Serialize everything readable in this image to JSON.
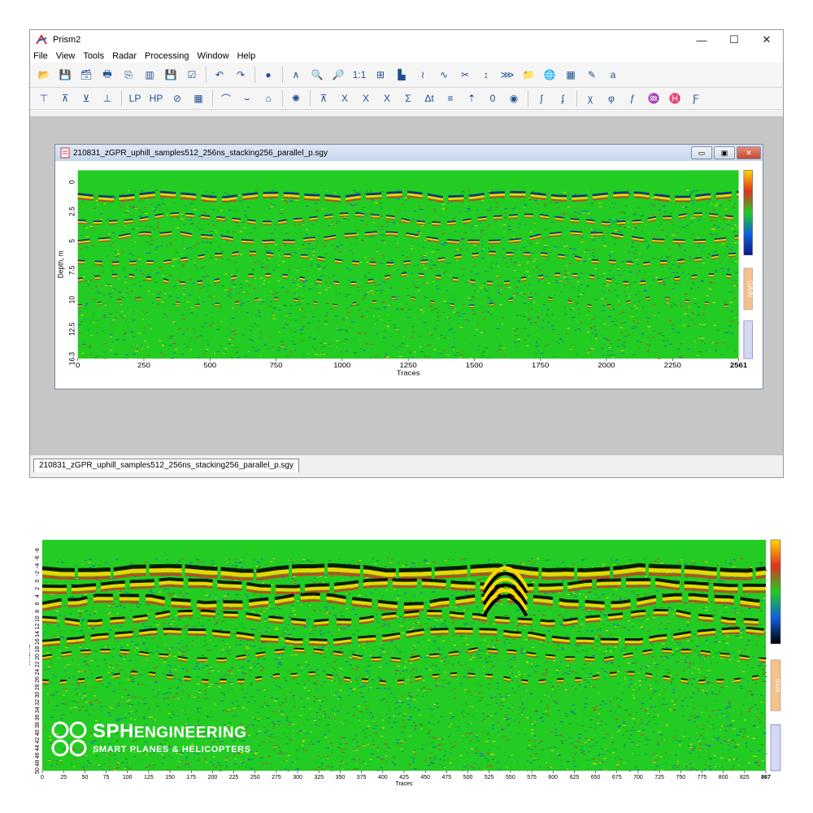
{
  "app": {
    "title": "Prism2",
    "minimize_glyph": "—",
    "maximize_glyph": "☐",
    "close_glyph": "✕"
  },
  "menu": {
    "items": [
      {
        "label": "File"
      },
      {
        "label": "View"
      },
      {
        "label": "Tools"
      },
      {
        "label": "Radar"
      },
      {
        "label": "Processing"
      },
      {
        "label": "Window"
      },
      {
        "label": "Help"
      }
    ]
  },
  "toolbar1": {
    "buttons": [
      {
        "icon": "open-folder-icon",
        "glyph": "📂"
      },
      {
        "icon": "save-icon",
        "glyph": "💾"
      },
      {
        "icon": "save-all-icon",
        "glyph": "🗃"
      },
      {
        "icon": "print-icon",
        "glyph": "🖶"
      },
      {
        "icon": "export-icon",
        "glyph": "⎘"
      },
      {
        "icon": "palette-icon",
        "glyph": "▥"
      },
      {
        "icon": "floppy-icon",
        "glyph": "💾"
      },
      {
        "icon": "check-icon",
        "glyph": "☑"
      },
      {
        "icon": "undo-icon",
        "glyph": "↶"
      },
      {
        "icon": "redo-icon",
        "glyph": "↷"
      },
      {
        "icon": "marker-icon",
        "glyph": "●"
      },
      {
        "icon": "hyperbola-icon",
        "glyph": "∧"
      },
      {
        "icon": "zoom-in-icon",
        "glyph": "🔍"
      },
      {
        "icon": "zoom-out-icon",
        "glyph": "🔎"
      },
      {
        "icon": "zoom-1-1-icon",
        "glyph": "1:1"
      },
      {
        "icon": "fit-icon",
        "glyph": "⊞"
      },
      {
        "icon": "histogram-icon",
        "glyph": "▙"
      },
      {
        "icon": "wave-icon",
        "glyph": "≀"
      },
      {
        "icon": "trace-icon",
        "glyph": "∿"
      },
      {
        "icon": "cut-icon",
        "glyph": "✂"
      },
      {
        "icon": "vertical-arrow-icon",
        "glyph": "↕"
      },
      {
        "icon": "signal-icon",
        "glyph": "⋙"
      },
      {
        "icon": "folder-edit-icon",
        "glyph": "📁"
      },
      {
        "icon": "globe-icon",
        "glyph": "🌐"
      },
      {
        "icon": "gps-icon",
        "glyph": "▦"
      },
      {
        "icon": "report-icon",
        "glyph": "✎"
      },
      {
        "icon": "language-icon",
        "glyph": "a"
      }
    ]
  },
  "toolbar2": {
    "buttons": [
      {
        "icon": "filter-1-icon",
        "glyph": "⊤"
      },
      {
        "icon": "filter-2-icon",
        "glyph": "⊼"
      },
      {
        "icon": "filter-3-icon",
        "glyph": "⊻"
      },
      {
        "icon": "filter-4-icon",
        "glyph": "⊥"
      },
      {
        "icon": "low-pass-icon",
        "glyph": "LP"
      },
      {
        "icon": "high-pass-icon",
        "glyph": "HP"
      },
      {
        "icon": "band-icon",
        "glyph": "⊘"
      },
      {
        "icon": "grid-icon",
        "glyph": "▦"
      },
      {
        "icon": "arc-up-icon",
        "glyph": "⌒"
      },
      {
        "icon": "arc-down-icon",
        "glyph": "⌣"
      },
      {
        "icon": "house-icon",
        "glyph": "⌂"
      },
      {
        "icon": "migration-icon",
        "glyph": "✺"
      },
      {
        "icon": "topo-icon",
        "glyph": "⊼"
      },
      {
        "icon": "xm-icon",
        "glyph": "X"
      },
      {
        "icon": "xr-icon",
        "glyph": "X"
      },
      {
        "icon": "x-gps-icon",
        "glyph": "X"
      },
      {
        "icon": "sum-icon",
        "glyph": "Σ"
      },
      {
        "icon": "delta-t-icon",
        "glyph": "Δt"
      },
      {
        "icon": "level-icon",
        "glyph": "≡"
      },
      {
        "icon": "shift-up-icon",
        "glyph": "⇡"
      },
      {
        "icon": "zero-icon",
        "glyph": "0"
      },
      {
        "icon": "pb-icon",
        "glyph": "◉"
      },
      {
        "icon": "spec-1-icon",
        "glyph": "ʃ"
      },
      {
        "icon": "spec-2-icon",
        "glyph": "ʄ"
      },
      {
        "icon": "sigma-icon",
        "glyph": "χ"
      },
      {
        "icon": "phi-icon",
        "glyph": "φ"
      },
      {
        "icon": "f-icon",
        "glyph": "ƒ"
      },
      {
        "icon": "gain-1-icon",
        "glyph": "♒"
      },
      {
        "icon": "gain-2-icon",
        "glyph": "♓"
      },
      {
        "icon": "fx-icon",
        "glyph": "Ƒ"
      }
    ]
  },
  "document": {
    "title": "210831_zGPR_uphill_samples512_256ns_stacking256_parallel_p.sgy",
    "tab_label": "210831_zGPR_uphill_samples512_256ns_stacking256_parallel_p.sgy"
  },
  "chart_data": [
    {
      "type": "heatmap",
      "title": "",
      "xlabel": "Traces",
      "ylabel": "Depth, m",
      "xlim": [
        0,
        2561
      ],
      "ylim": [
        16.3,
        0
      ],
      "x_ticks": [
        "0",
        "250",
        "500",
        "750",
        "1000",
        "1250",
        "1500",
        "1750",
        "2000",
        "2250",
        "2561"
      ],
      "y_ticks": [
        "0",
        "2.5",
        "5",
        "7.5",
        "10",
        "12.5",
        "16.3"
      ],
      "colors": {
        "background": "#22cc22",
        "positive": "#ffd800",
        "negative": "#0a1a8a",
        "mid_pos": "#e03020",
        "mid_neg": "#1060e0"
      },
      "side_scale_label": "GAIN"
    },
    {
      "type": "heatmap",
      "title": "",
      "xlabel": "Traces",
      "ylabel": "Time, ns",
      "xlim": [
        0,
        867
      ],
      "x_ticks": [
        "0",
        "25",
        "50",
        "75",
        "100",
        "125",
        "150",
        "175",
        "200",
        "225",
        "250",
        "275",
        "300",
        "325",
        "350",
        "375",
        "400",
        "425",
        "450",
        "475",
        "500",
        "525",
        "550",
        "575",
        "600",
        "625",
        "650",
        "675",
        "700",
        "725",
        "750",
        "775",
        "800",
        "825",
        "867"
      ],
      "y_ticks": [
        "-8",
        "-6",
        "-4",
        "-2",
        "0",
        "2",
        "4",
        "6",
        "8",
        "10",
        "12",
        "14",
        "16",
        "18",
        "20",
        "22",
        "24",
        "26",
        "28",
        "30",
        "32",
        "34",
        "36",
        "38",
        "40",
        "42",
        "44",
        "46",
        "48",
        "50"
      ],
      "colors": {
        "background": "#22cc22",
        "positive": "#ffd800",
        "negative": "#000000",
        "mid_pos": "#e03020",
        "mid_neg": "#1060e0"
      },
      "side_scale_label": "GAIN"
    }
  ],
  "logo": {
    "main_bold": "SPH",
    "main_rest": "ENGINEERING",
    "sub": "SMART PLANES & HELICOPTERS"
  }
}
